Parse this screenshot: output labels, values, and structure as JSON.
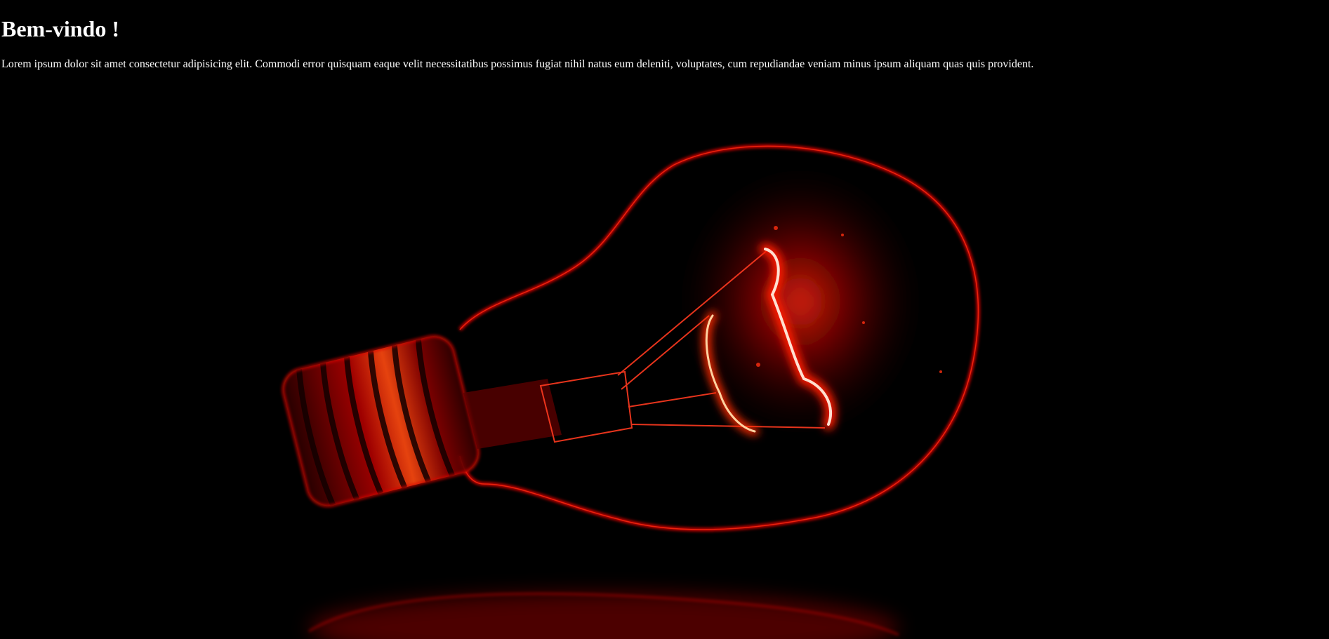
{
  "page": {
    "title": "Bem-vindo !",
    "text": "Lorem ipsum dolor sit amet consectetur adipisicing elit. Commodi error quisquam eaque velit necessitatibus possimus fugiat nihil natus eum deleniti, voluptates, cum repudiandae veniam minus ipsum aliquam quas quis provident."
  },
  "colors": {
    "background": "#000000",
    "text": "#ffffff",
    "glow": "#ff1a00"
  },
  "image": {
    "subject": "glowing-red-light-bulb"
  }
}
